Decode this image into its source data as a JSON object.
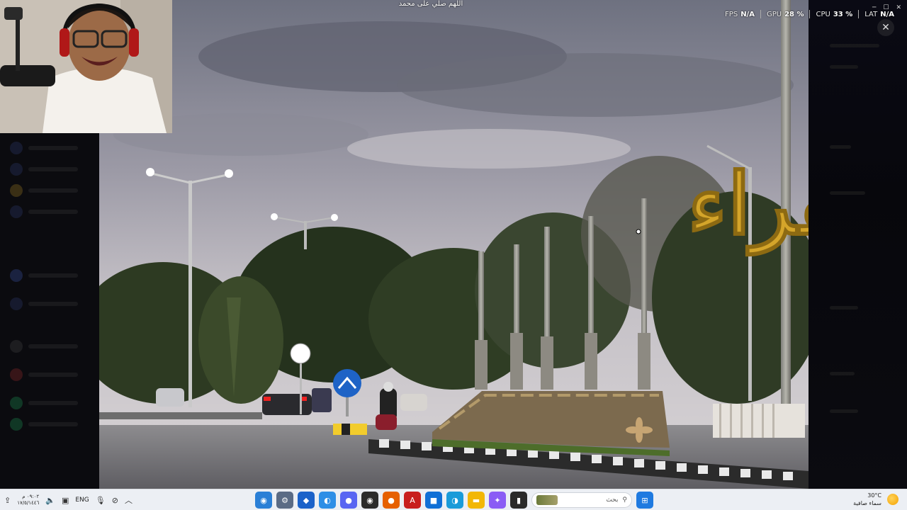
{
  "stream": {
    "top_caption": "اللهم صلي على محمد",
    "sign_text": "شقراء"
  },
  "perf_overlay": {
    "fps_label": "FPS",
    "fps_value": "N/A",
    "gpu_label": "GPU",
    "gpu_value": "28 %",
    "cpu_label": "CPU",
    "cpu_value": "33 %",
    "lat_label": "LAT",
    "lat_value": "N/A"
  },
  "window": {
    "close_symbol": "✕"
  },
  "taskbar": {
    "clock_time": "٠٩:٠٢ م",
    "clock_date": "١٧/٥/١٤٤٦",
    "language": "ENG",
    "search_placeholder": "بحث",
    "apps": [
      {
        "name": "chrome-icon",
        "color": "#2a7fd6",
        "glyph": "◉"
      },
      {
        "name": "settings-icon",
        "color": "#5a6b85",
        "glyph": "⚙"
      },
      {
        "name": "shield-icon",
        "color": "#1b62c9",
        "glyph": "◆"
      },
      {
        "name": "edge-dev-icon",
        "color": "#2d8ee6",
        "glyph": "◐"
      },
      {
        "name": "discord-icon",
        "color": "#5865f2",
        "glyph": "●"
      },
      {
        "name": "obs-icon",
        "color": "#2b2b2b",
        "glyph": "◉"
      },
      {
        "name": "firefox-icon",
        "color": "#e66000",
        "glyph": "●"
      },
      {
        "name": "acrobat-icon",
        "color": "#c81e1e",
        "glyph": "A"
      },
      {
        "name": "store-icon",
        "color": "#0f6fd6",
        "glyph": "■"
      },
      {
        "name": "edge-icon",
        "color": "#1a9bd9",
        "glyph": "◑"
      },
      {
        "name": "files-icon",
        "color": "#f2b705",
        "glyph": "▬"
      },
      {
        "name": "copilot-icon",
        "color": "#8a5cf5",
        "glyph": "✦"
      },
      {
        "name": "terminal-icon",
        "color": "#2a2a2a",
        "glyph": "▮"
      }
    ]
  },
  "weather": {
    "temperature": "30°C",
    "condition": "سماء صافية"
  },
  "colors": {
    "sign_gold": "#d4a52a",
    "taskbar_bg": "#eceff4"
  }
}
